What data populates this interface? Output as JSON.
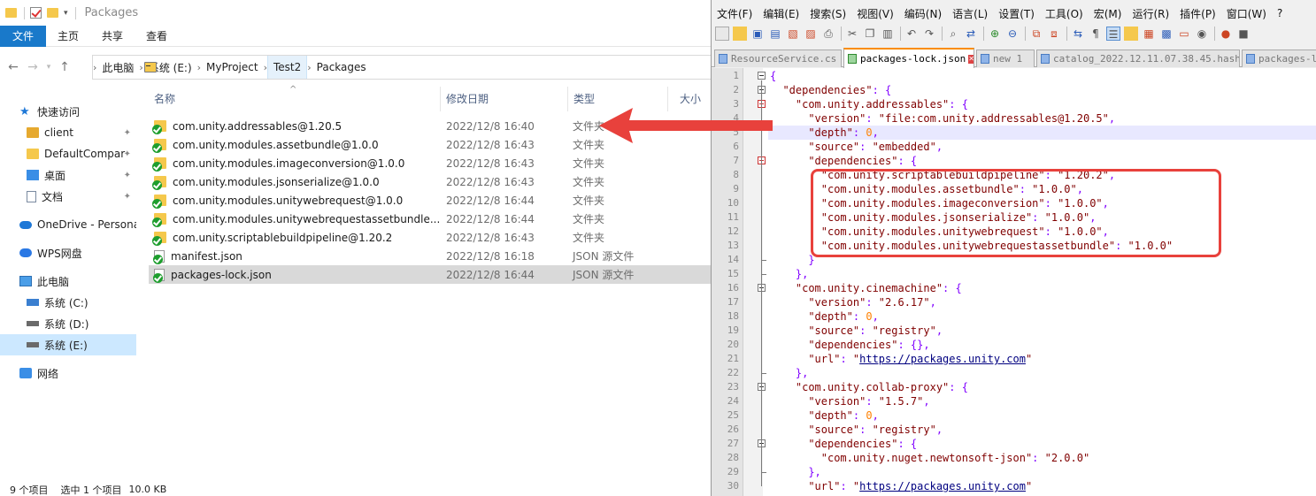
{
  "explorer": {
    "title": "Packages",
    "ribbon_tabs": [
      "文件",
      "主页",
      "共享",
      "查看"
    ],
    "breadcrumbs": [
      "此电脑",
      "系统 (E:)",
      "MyProject",
      "Test2",
      "Packages"
    ],
    "nav": {
      "items": [
        {
          "label": "快速访问",
          "icon": "star-icon",
          "pinned": false
        },
        {
          "label": "client",
          "icon": "folder-user-icon",
          "pinned": true
        },
        {
          "label": "DefaultCompar",
          "icon": "folder-icon",
          "pinned": true
        },
        {
          "label": "桌面",
          "icon": "desktop-icon",
          "pinned": true
        },
        {
          "label": "文档",
          "icon": "documents-icon",
          "pinned": true
        },
        {
          "label": "OneDrive - Persona",
          "icon": "cloud-icon",
          "pinned": false
        },
        {
          "label": "WPS网盘",
          "icon": "wps-cloud-icon",
          "pinned": false
        },
        {
          "label": "此电脑",
          "icon": "computer-icon",
          "pinned": false
        },
        {
          "label": "系统 (C:)",
          "icon": "drive-icon",
          "pinned": false
        },
        {
          "label": "系统 (D:)",
          "icon": "drive-icon",
          "pinned": false
        },
        {
          "label": "系统 (E:)",
          "icon": "drive-icon",
          "pinned": false,
          "selected": true
        },
        {
          "label": "网络",
          "icon": "network-icon",
          "pinned": false
        }
      ]
    },
    "columns": [
      "名称",
      "修改日期",
      "类型",
      "大小"
    ],
    "files": [
      {
        "name": "com.unity.addressables@1.20.5",
        "date": "2022/12/8 16:40",
        "type": "文件夹",
        "kind": "folder"
      },
      {
        "name": "com.unity.modules.assetbundle@1.0.0",
        "date": "2022/12/8 16:43",
        "type": "文件夹",
        "kind": "folder"
      },
      {
        "name": "com.unity.modules.imageconversion@1.0.0",
        "date": "2022/12/8 16:43",
        "type": "文件夹",
        "kind": "folder"
      },
      {
        "name": "com.unity.modules.jsonserialize@1.0.0",
        "date": "2022/12/8 16:43",
        "type": "文件夹",
        "kind": "folder"
      },
      {
        "name": "com.unity.modules.unitywebrequest@1.0.0",
        "date": "2022/12/8 16:44",
        "type": "文件夹",
        "kind": "folder"
      },
      {
        "name": "com.unity.modules.unitywebrequestassetbundle...",
        "date": "2022/12/8 16:44",
        "type": "文件夹",
        "kind": "folder"
      },
      {
        "name": "com.unity.scriptablebuildpipeline@1.20.2",
        "date": "2022/12/8 16:43",
        "type": "文件夹",
        "kind": "folder"
      },
      {
        "name": "manifest.json",
        "date": "2022/12/8 16:18",
        "type": "JSON 源文件",
        "kind": "file"
      },
      {
        "name": "packages-lock.json",
        "date": "2022/12/8 16:44",
        "type": "JSON 源文件",
        "kind": "file",
        "selected": true
      }
    ],
    "status": {
      "count": "9 个项目",
      "selected": "选中 1 个项目",
      "size": "10.0 KB"
    }
  },
  "notepad": {
    "menu": [
      "文件(F)",
      "编辑(E)",
      "搜索(S)",
      "视图(V)",
      "编码(N)",
      "语言(L)",
      "设置(T)",
      "工具(O)",
      "宏(M)",
      "运行(R)",
      "插件(P)",
      "窗口(W)",
      "?"
    ],
    "tabs": [
      {
        "label": "ResourceService.cs",
        "active": false
      },
      {
        "label": "packages-lock.json",
        "active": true
      },
      {
        "label": "new 1",
        "active": false
      },
      {
        "label": "catalog_2022.12.11.07.38.45.hash",
        "active": false
      },
      {
        "label": "packages-lo",
        "active": false
      }
    ],
    "lines": [
      {
        "n": "1",
        "indent": 0,
        "t": [
          [
            "p",
            "{"
          ]
        ]
      },
      {
        "n": "2",
        "indent": 2,
        "t": [
          [
            "s",
            "\"dependencies\""
          ],
          [
            "p",
            ": {"
          ]
        ]
      },
      {
        "n": "3",
        "indent": 4,
        "t": [
          [
            "s",
            "\"com.unity.addressables\""
          ],
          [
            "p",
            ": {"
          ]
        ]
      },
      {
        "n": "4",
        "indent": 6,
        "t": [
          [
            "s",
            "\"version\""
          ],
          [
            "p",
            ": "
          ],
          [
            "s",
            "\"file:com.unity.addressables@1.20.5\""
          ],
          [
            "p",
            ","
          ]
        ]
      },
      {
        "n": "5",
        "indent": 6,
        "t": [
          [
            "s",
            "\"depth\""
          ],
          [
            "p",
            ": "
          ],
          [
            "n",
            "0"
          ],
          [
            "p",
            ","
          ]
        ]
      },
      {
        "n": "6",
        "indent": 6,
        "t": [
          [
            "s",
            "\"source\""
          ],
          [
            "p",
            ": "
          ],
          [
            "s",
            "\"embedded\""
          ],
          [
            "p",
            ","
          ]
        ]
      },
      {
        "n": "7",
        "indent": 6,
        "t": [
          [
            "s",
            "\"dependencies\""
          ],
          [
            "p",
            ": {"
          ]
        ]
      },
      {
        "n": "8",
        "indent": 8,
        "t": [
          [
            "s",
            "\"com.unity.scriptablebuildpipeline\""
          ],
          [
            "p",
            ": "
          ],
          [
            "s",
            "\"1.20.2\""
          ],
          [
            "p",
            ","
          ]
        ]
      },
      {
        "n": "9",
        "indent": 8,
        "t": [
          [
            "s",
            "\"com.unity.modules.assetbundle\""
          ],
          [
            "p",
            ": "
          ],
          [
            "s",
            "\"1.0.0\""
          ],
          [
            "p",
            ","
          ]
        ]
      },
      {
        "n": "10",
        "indent": 8,
        "t": [
          [
            "s",
            "\"com.unity.modules.imageconversion\""
          ],
          [
            "p",
            ": "
          ],
          [
            "s",
            "\"1.0.0\""
          ],
          [
            "p",
            ","
          ]
        ]
      },
      {
        "n": "11",
        "indent": 8,
        "t": [
          [
            "s",
            "\"com.unity.modules.jsonserialize\""
          ],
          [
            "p",
            ": "
          ],
          [
            "s",
            "\"1.0.0\""
          ],
          [
            "p",
            ","
          ]
        ]
      },
      {
        "n": "12",
        "indent": 8,
        "t": [
          [
            "s",
            "\"com.unity.modules.unitywebrequest\""
          ],
          [
            "p",
            ": "
          ],
          [
            "s",
            "\"1.0.0\""
          ],
          [
            "p",
            ","
          ]
        ]
      },
      {
        "n": "13",
        "indent": 8,
        "t": [
          [
            "s",
            "\"com.unity.modules.unitywebrequestassetbundle\""
          ],
          [
            "p",
            ": "
          ],
          [
            "s",
            "\"1.0.0\""
          ]
        ]
      },
      {
        "n": "14",
        "indent": 6,
        "t": [
          [
            "p",
            "}"
          ]
        ]
      },
      {
        "n": "15",
        "indent": 4,
        "t": [
          [
            "p",
            "},"
          ]
        ]
      },
      {
        "n": "16",
        "indent": 4,
        "t": [
          [
            "s",
            "\"com.unity.cinemachine\""
          ],
          [
            "p",
            ": {"
          ]
        ]
      },
      {
        "n": "17",
        "indent": 6,
        "t": [
          [
            "s",
            "\"version\""
          ],
          [
            "p",
            ": "
          ],
          [
            "s",
            "\"2.6.17\""
          ],
          [
            "p",
            ","
          ]
        ]
      },
      {
        "n": "18",
        "indent": 6,
        "t": [
          [
            "s",
            "\"depth\""
          ],
          [
            "p",
            ": "
          ],
          [
            "n",
            "0"
          ],
          [
            "p",
            ","
          ]
        ]
      },
      {
        "n": "19",
        "indent": 6,
        "t": [
          [
            "s",
            "\"source\""
          ],
          [
            "p",
            ": "
          ],
          [
            "s",
            "\"registry\""
          ],
          [
            "p",
            ","
          ]
        ]
      },
      {
        "n": "20",
        "indent": 6,
        "t": [
          [
            "s",
            "\"dependencies\""
          ],
          [
            "p",
            ": {},"
          ]
        ]
      },
      {
        "n": "21",
        "indent": 6,
        "t": [
          [
            "s",
            "\"url\""
          ],
          [
            "p",
            ": "
          ],
          [
            "s",
            "\""
          ],
          [
            "u",
            "https://packages.unity.com"
          ],
          [
            "s",
            "\""
          ]
        ]
      },
      {
        "n": "22",
        "indent": 4,
        "t": [
          [
            "p",
            "},"
          ]
        ]
      },
      {
        "n": "23",
        "indent": 4,
        "t": [
          [
            "s",
            "\"com.unity.collab-proxy\""
          ],
          [
            "p",
            ": {"
          ]
        ]
      },
      {
        "n": "24",
        "indent": 6,
        "t": [
          [
            "s",
            "\"version\""
          ],
          [
            "p",
            ": "
          ],
          [
            "s",
            "\"1.5.7\""
          ],
          [
            "p",
            ","
          ]
        ]
      },
      {
        "n": "25",
        "indent": 6,
        "t": [
          [
            "s",
            "\"depth\""
          ],
          [
            "p",
            ": "
          ],
          [
            "n",
            "0"
          ],
          [
            "p",
            ","
          ]
        ]
      },
      {
        "n": "26",
        "indent": 6,
        "t": [
          [
            "s",
            "\"source\""
          ],
          [
            "p",
            ": "
          ],
          [
            "s",
            "\"registry\""
          ],
          [
            "p",
            ","
          ]
        ]
      },
      {
        "n": "27",
        "indent": 6,
        "t": [
          [
            "s",
            "\"dependencies\""
          ],
          [
            "p",
            ": {"
          ]
        ]
      },
      {
        "n": "28",
        "indent": 8,
        "t": [
          [
            "s",
            "\"com.unity.nuget.newtonsoft-json\""
          ],
          [
            "p",
            ": "
          ],
          [
            "s",
            "\"2.0.0\""
          ]
        ]
      },
      {
        "n": "29",
        "indent": 6,
        "t": [
          [
            "p",
            "},"
          ]
        ]
      },
      {
        "n": "30",
        "indent": 6,
        "t": [
          [
            "s",
            "\"url\""
          ],
          [
            "p",
            ": "
          ],
          [
            "s",
            "\""
          ],
          [
            "u",
            "https://packages.unity.com"
          ],
          [
            "s",
            "\""
          ]
        ]
      }
    ]
  },
  "colors": {
    "annotation": "#e8413c",
    "ribbon_active": "#1979ca",
    "tab_accent": "#fa8c00"
  }
}
